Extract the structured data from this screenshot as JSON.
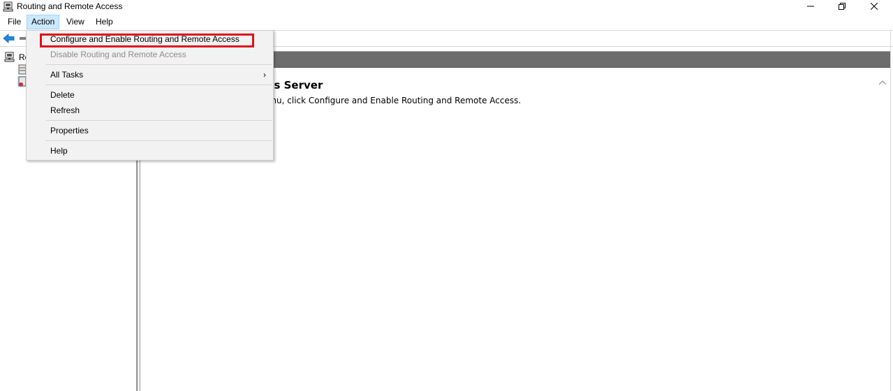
{
  "window": {
    "title": "Routing and Remote Access",
    "icon": "server-console-icon",
    "controls": [
      "minimize-icon",
      "restore-icon",
      "close-icon"
    ]
  },
  "menubar": {
    "file": "File",
    "action": "Action",
    "view": "View",
    "help": "Help",
    "active": "Action"
  },
  "toolbar": {
    "icons": [
      "back-arrow-icon",
      "forward-arrow-icon"
    ]
  },
  "tree": {
    "root_label": "Routing and Remote Access",
    "root_visible_label": "Ro",
    "children_icons": [
      "server-status-icon",
      "server-down-icon"
    ]
  },
  "content": {
    "title_visible": "and Remote Access Server",
    "description_visible": "Access, on the Action menu, click Configure and Enable Routing and Remote Access."
  },
  "action_menu": {
    "configure": "Configure and Enable Routing and Remote Access",
    "disable": "Disable Routing and Remote Access",
    "all_tasks": "All Tasks",
    "all_tasks_arrow": "›",
    "delete": "Delete",
    "refresh": "Refresh",
    "properties": "Properties",
    "help": "Help",
    "highlighted_item": "configure",
    "highlight_color": "#e0101c"
  }
}
